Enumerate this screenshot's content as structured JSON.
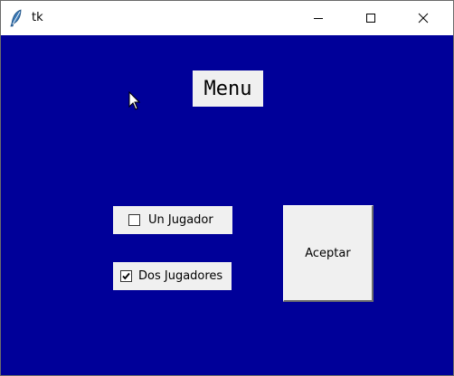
{
  "window": {
    "title": "tk",
    "icons": {
      "app": "feather-icon",
      "minimize": "minimize-icon",
      "maximize": "maximize-icon",
      "close": "close-icon"
    }
  },
  "content": {
    "background_color": "#000099",
    "heading": "Menu",
    "options": [
      {
        "label": "Un Jugador",
        "checked": false
      },
      {
        "label": "Dos Jugadores",
        "checked": true
      }
    ],
    "accept_label": "Aceptar"
  }
}
